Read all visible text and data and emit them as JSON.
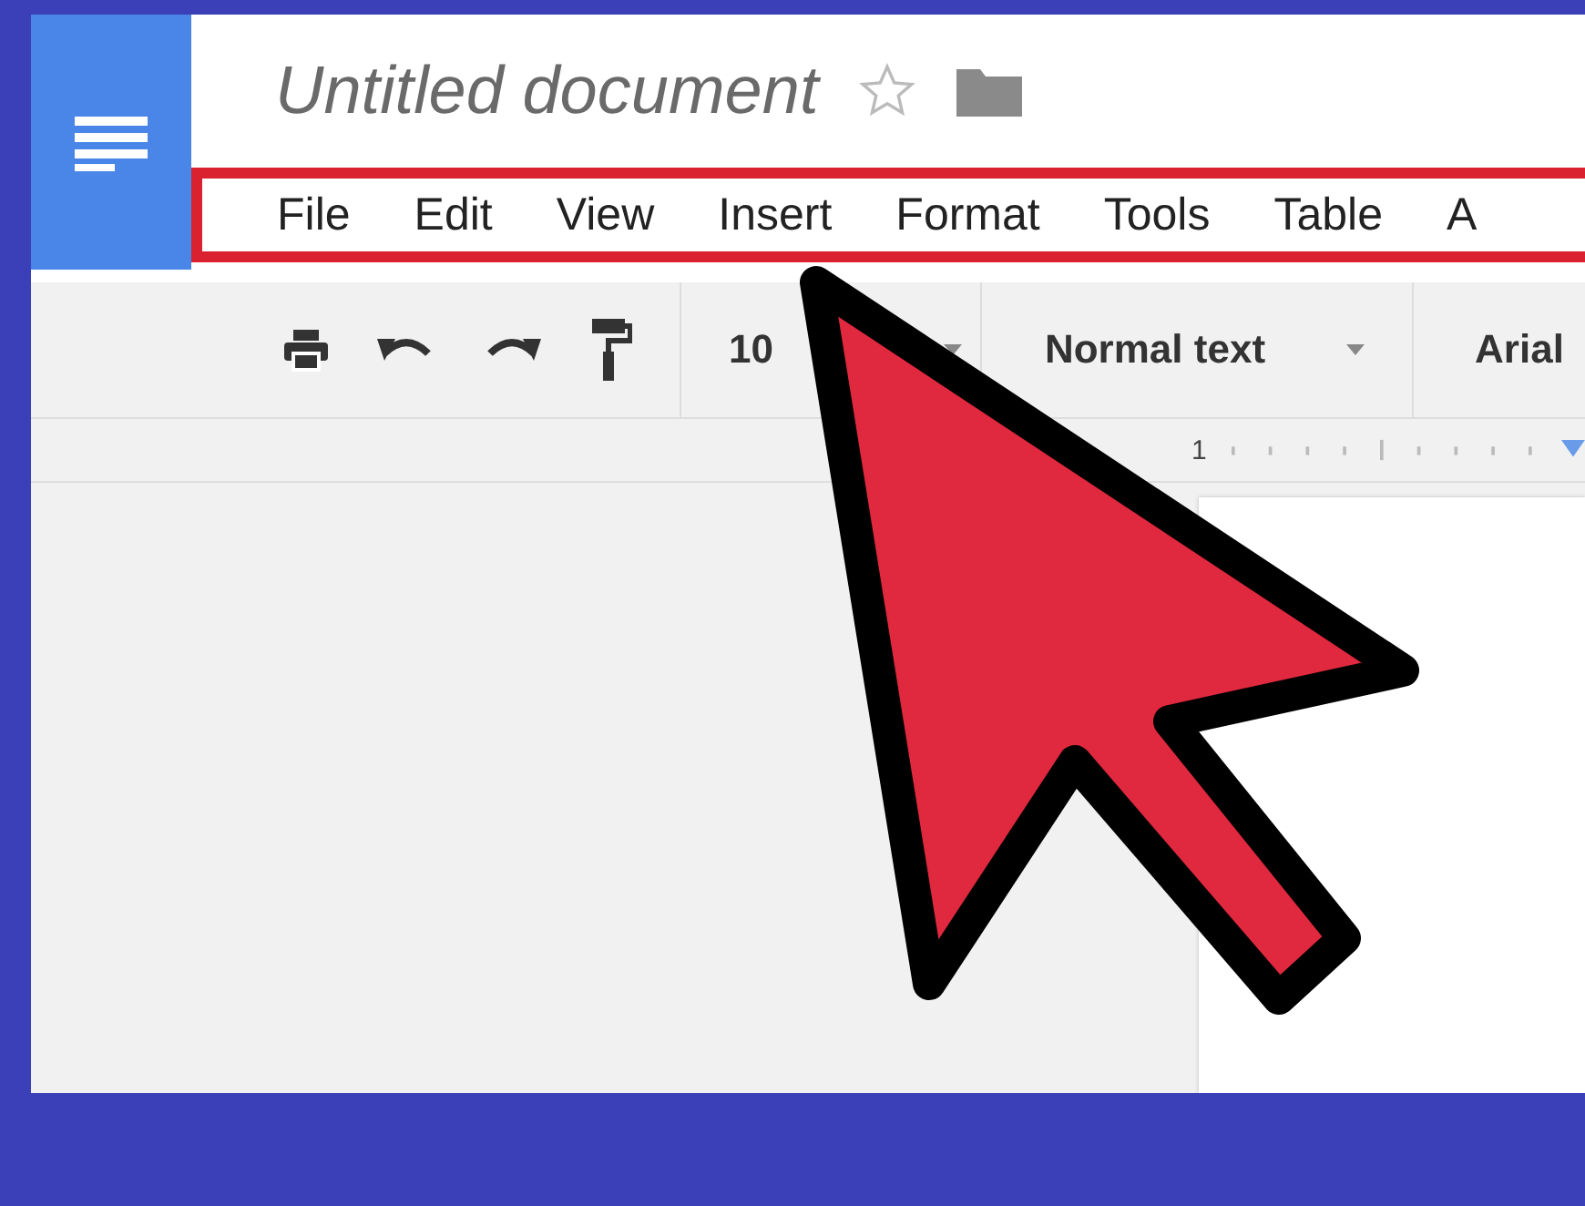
{
  "document": {
    "title": "Untitled document"
  },
  "menu_bar": {
    "highlighted": true,
    "items": [
      "File",
      "Edit",
      "View",
      "Insert",
      "Format",
      "Tools",
      "Table",
      "A"
    ]
  },
  "toolbar": {
    "font_size": "10",
    "style": "Normal text",
    "font": "Arial"
  },
  "ruler": {
    "marker": "1"
  }
}
